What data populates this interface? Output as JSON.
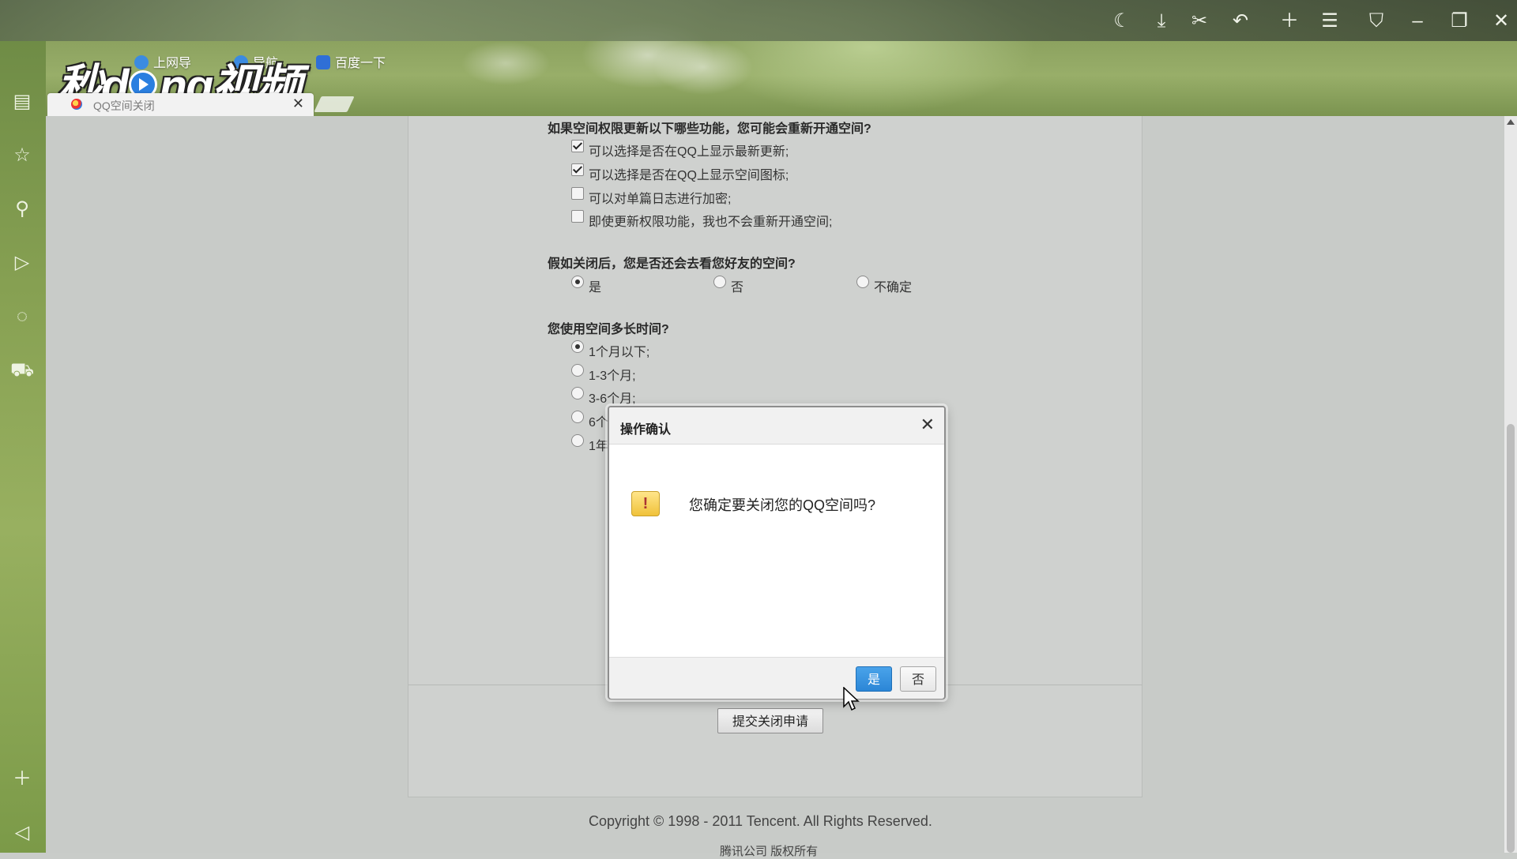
{
  "browser": {
    "toolbar_icons": [
      "moon-icon",
      "download-icon",
      "scissors-icon",
      "undo-icon",
      "plus-icon",
      "menu-icon",
      "skin-icon",
      "minimize-icon",
      "restore-icon",
      "close-icon"
    ],
    "bookmarks": [
      {
        "label": "上网导",
        "icon": "ie-icon"
      },
      {
        "label": "导航",
        "icon": "ie-icon"
      },
      {
        "label": "百度一下",
        "icon": "baidu-paw-icon"
      }
    ],
    "tab": {
      "title": "QQ空间关闭",
      "close": "✕"
    },
    "watermark": "秒dong视频"
  },
  "sidebar": {
    "icons": [
      "news-icon",
      "star-icon",
      "search-icon",
      "video-icon",
      "chat-icon",
      "cart-icon"
    ],
    "bottom_icons": [
      "add-icon",
      "collapse-icon"
    ]
  },
  "form": {
    "q1": {
      "label": "如果空间权限更新以下哪些功能，您可能会重新开通空间?",
      "options": [
        {
          "label": "可以选择是否在QQ上显示最新更新;",
          "checked": true
        },
        {
          "label": "可以选择是否在QQ上显示空间图标;",
          "checked": true
        },
        {
          "label": "可以对单篇日志进行加密;",
          "checked": false
        },
        {
          "label": "即使更新权限功能，我也不会重新开通空间;",
          "checked": false
        }
      ]
    },
    "q2": {
      "label": "假如关闭后，您是否还会去看您好友的空间?",
      "options": [
        {
          "label": "是",
          "checked": true
        },
        {
          "label": "否",
          "checked": false
        },
        {
          "label": "不确定",
          "checked": false
        }
      ]
    },
    "q3": {
      "label": "您使用空间多长时间?",
      "options": [
        {
          "label": "1个月以下;",
          "checked": true
        },
        {
          "label": "1-3个月;",
          "checked": false
        },
        {
          "label": "3-6个月;",
          "checked": false
        },
        {
          "label": "6个",
          "checked": false
        },
        {
          "label": "1年",
          "checked": false
        }
      ]
    },
    "submit_label": "提交关闭申请"
  },
  "dialog": {
    "title": "操作确认",
    "close": "✕",
    "message": "您确定要关闭您的QQ空间吗?",
    "yes_label": "是",
    "no_label": "否"
  },
  "footer": {
    "copyright": "Copyright © 1998 - 2011 Tencent. All Rights Reserved.",
    "company": "腾讯公司 版权所有"
  },
  "colors": {
    "accent_button": "#2b86d6",
    "sidebar_green": "#86a052"
  }
}
